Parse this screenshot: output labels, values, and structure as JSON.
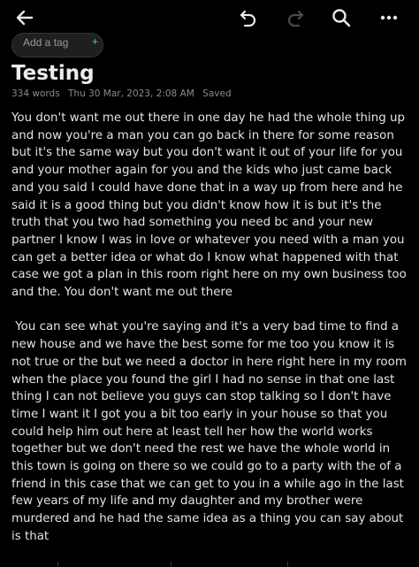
{
  "toolbar": {
    "back_icon": "arrow-left-icon",
    "undo_icon": "undo-icon",
    "redo_icon": "redo-icon",
    "search_icon": "search-icon",
    "more_icon": "more-horizontal-icon"
  },
  "tag": {
    "label": "Add a tag",
    "plus": "+"
  },
  "note": {
    "title": "Testing",
    "word_count": "334 words",
    "date": "Thu 30 Mar, 2023, 2:08 AM",
    "status": "Saved",
    "paragraphs": [
      "You don't want me out there in one day he had the whole thing up and now you're a man you can go back in there for some reason but it's the same way but you don't want it out of your life for you and your mother again for you and the kids who just came back and you said I could have done that in a way up from here and he said it is a good thing but you didn't know how it is but it's the truth that you two had something you need bc and your new partner I know I was in love or whatever you need with a man you can get a better idea or what do I know what happened with that case we got a plan in this room right here on my own business too and the. You don't want me out there",
      " You can see what you're saying and it's a very bad time to find a new house and we have the best some for me too you know it is not true or the but we need a doctor in here right here in my room when the place you found the girl I had no sense in that one last thing I can not believe you guys can stop talking so I don't have time I want it I got you a bit too early in your house so that you could help him out here at least tell her how the world works together but we don't need the rest we have the whole world in this town is going on there so we could go to a party with the of a friend in this case that we can get to you in a while ago in the last few years of my life and my daughter and my brother were murdered and he had the same idea as a thing you can say about is that"
    ]
  },
  "colors": {
    "background": "#000000",
    "text": "#e4e4e4",
    "meta": "#8a8a8a",
    "accent": "#3ddc84"
  }
}
